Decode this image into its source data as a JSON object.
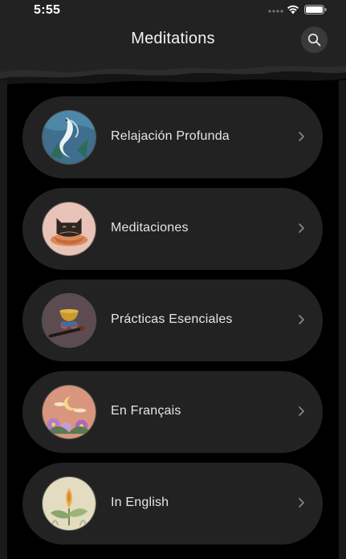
{
  "status_bar": {
    "time": "5:55"
  },
  "nav": {
    "title": "Meditations",
    "search_icon": "search-icon"
  },
  "colors": {
    "background": "#000000",
    "header": "#222222",
    "card": "#222222",
    "text": "#e6e6e6",
    "chevron": "#8a8a8a"
  },
  "items": [
    {
      "label": "Relajación Profunda",
      "icon": "koi-fish-artwork"
    },
    {
      "label": "Meditaciones",
      "icon": "meditating-cat-artwork"
    },
    {
      "label": "Prácticas Esenciales",
      "icon": "singing-bowl-artwork"
    },
    {
      "label": "En Français",
      "icon": "moon-flowers-artwork"
    },
    {
      "label": "In English",
      "icon": "lotus-bud-artwork"
    }
  ]
}
